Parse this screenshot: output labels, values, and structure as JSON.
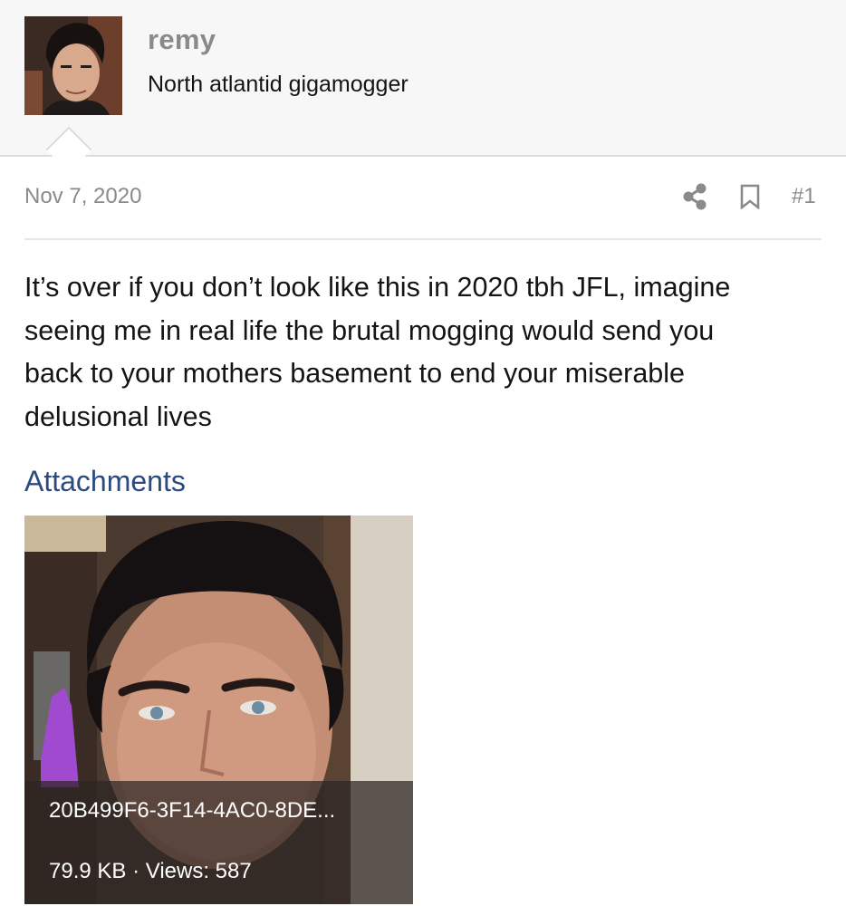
{
  "user": {
    "name": "remy",
    "title": "North atlantid gigamogger",
    "avatar": "avatar-photo"
  },
  "post": {
    "date": "Nov 7, 2020",
    "number": "#1",
    "share_icon": "share-icon",
    "bookmark_icon": "bookmark-icon",
    "lines": [
      "It’s over if you don’t look like this in 2020 tbh JFL, imagine",
      "seeing me in real life the brutal mogging would send you",
      "back to your mothers basement to end your miserable",
      "delusional lives"
    ]
  },
  "attachments": {
    "heading": "Attachments",
    "items": [
      {
        "filename": "20B499F6-3F14-4AC0-8DE...",
        "size": "79.9 KB",
        "separator": "·",
        "views": "Views: 587"
      }
    ]
  },
  "colors": {
    "header_bg": "#f7f7f7",
    "muted_text": "#8a8a8a",
    "link_blue": "#2b4a7e",
    "body_text": "#141414"
  }
}
